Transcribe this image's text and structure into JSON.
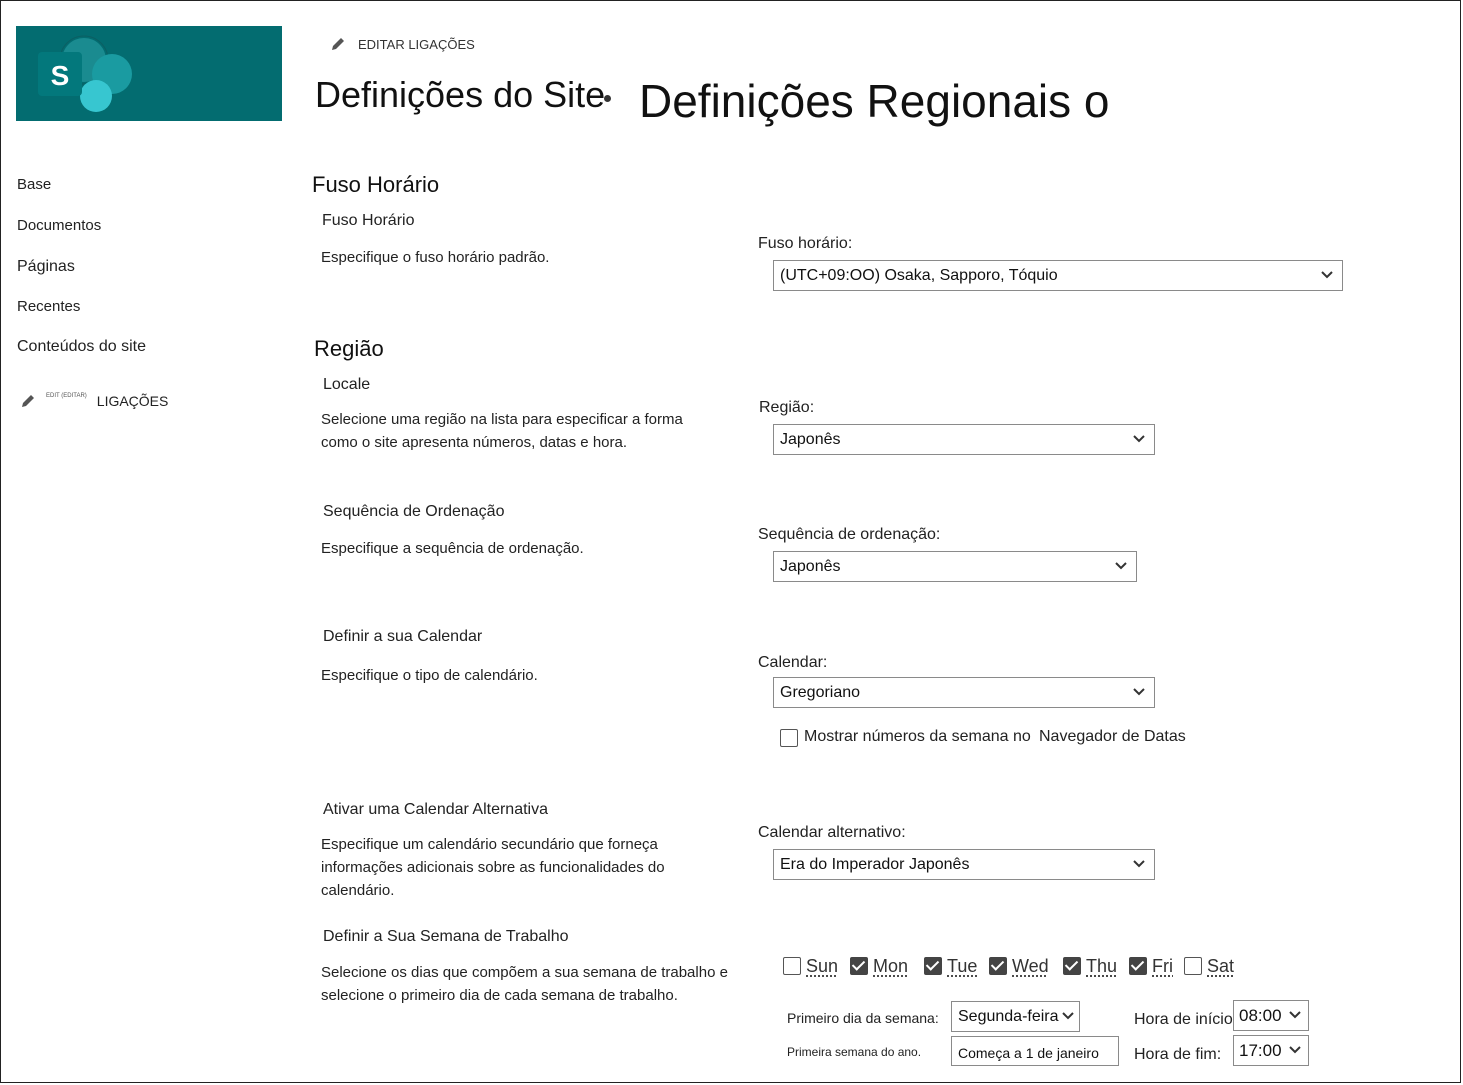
{
  "header": {
    "edit_links": "EDITAR LIGAÇÕES",
    "site_title": "Definições do Site",
    "page_title": "Definições Regionais o"
  },
  "nav": {
    "items": [
      "Base",
      "Documentos",
      "Páginas",
      "Recentes",
      "Conteúdos do site"
    ],
    "edit_tiny": "EDIT (EDITAR)",
    "edit_label": "LIGAÇÕES"
  },
  "timezone": {
    "section": "Fuso Horário",
    "subhead": "Fuso Horário",
    "desc": "Especifique o fuso horário padrão.",
    "label": "Fuso horário:",
    "value": "(UTC+09:OO) Osaka, Sapporo, Tóquio"
  },
  "region": {
    "section": "Região",
    "locale": {
      "subhead": "Locale",
      "desc": "Selecione uma região na lista para especificar a forma como o site apresenta números, datas e hora.",
      "label": "Região:",
      "value": "Japonês"
    },
    "sort": {
      "subhead": "Sequência de Ordenação",
      "desc": "Especifique a sequência de ordenação.",
      "label": "Sequência de ordenação:",
      "value": "Japonês"
    },
    "calendar": {
      "subhead": "Definir a sua Calendar",
      "desc": "Especifique o tipo de calendário.",
      "label": "Calendar:",
      "value": "Gregoriano",
      "week_numbers_label": "Mostrar números da semana no",
      "week_numbers_label2": "Navegador de Datas",
      "week_numbers_checked": false
    },
    "alt_calendar": {
      "subhead": "Ativar uma Calendar Alternativa",
      "desc": "Especifique um calendário secundário que forneça informações adicionais sobre as funcionalidades do calendário.",
      "label": "Calendar alternativo:",
      "value": "Era do Imperador Japonês"
    },
    "work_week": {
      "subhead": "Definir a Sua Semana de Trabalho",
      "desc": "Selecione os dias que compõem a sua semana de trabalho e selecione o primeiro dia de cada semana de trabalho.",
      "days": [
        {
          "label": "Sun",
          "checked": false
        },
        {
          "label": "Mon",
          "checked": true
        },
        {
          "label": "Tue",
          "checked": true
        },
        {
          "label": "Wed",
          "checked": true
        },
        {
          "label": "Thu",
          "checked": true
        },
        {
          "label": "Fri",
          "checked": true
        },
        {
          "label": "Sat",
          "checked": false
        }
      ],
      "first_day_label": "Primeiro dia da semana:",
      "first_day_value": "Segunda-feira",
      "first_week_label": "Primeira semana do ano.",
      "first_week_value": "Começa a 1 de janeiro",
      "start_label": "Hora de início:",
      "start_value": "08:00",
      "end_label": "Hora de fim:",
      "end_value": "17:00"
    }
  },
  "colors": {
    "brand": "#036c70",
    "brand_light": "#37c6d0",
    "brand_mid": "#1a9ba1"
  }
}
